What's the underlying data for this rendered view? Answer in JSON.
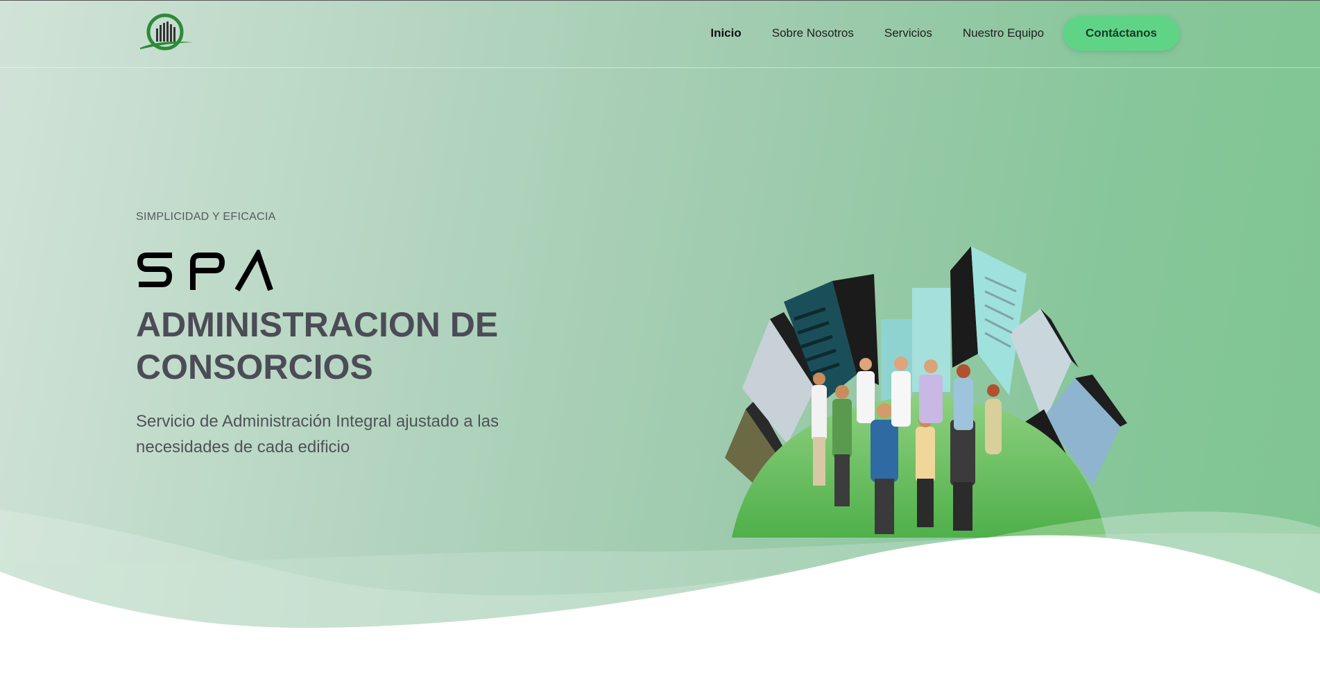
{
  "brand": {
    "logo_icon": "building-logo-icon",
    "wordmark": "SPA"
  },
  "nav": {
    "items": [
      {
        "label": "Inicio",
        "active": true
      },
      {
        "label": "Sobre Nosotros",
        "active": false
      },
      {
        "label": "Servicios",
        "active": false
      },
      {
        "label": "Nuestro Equipo",
        "active": false
      }
    ],
    "cta_label": "Contáctanos"
  },
  "hero": {
    "eyebrow": "SIMPLICIDAD Y EFICACIA",
    "title": "ADMINISTRACION DE CONSORCIOS",
    "subtitle": "Servicio de Administración Integral ajustado a las necesidades de cada edificio",
    "illustration": "city-team-meeting-illustration"
  },
  "colors": {
    "accent": "#5fd487",
    "title_text": "#4b4c55",
    "logo_green": "#2d8a3a"
  }
}
